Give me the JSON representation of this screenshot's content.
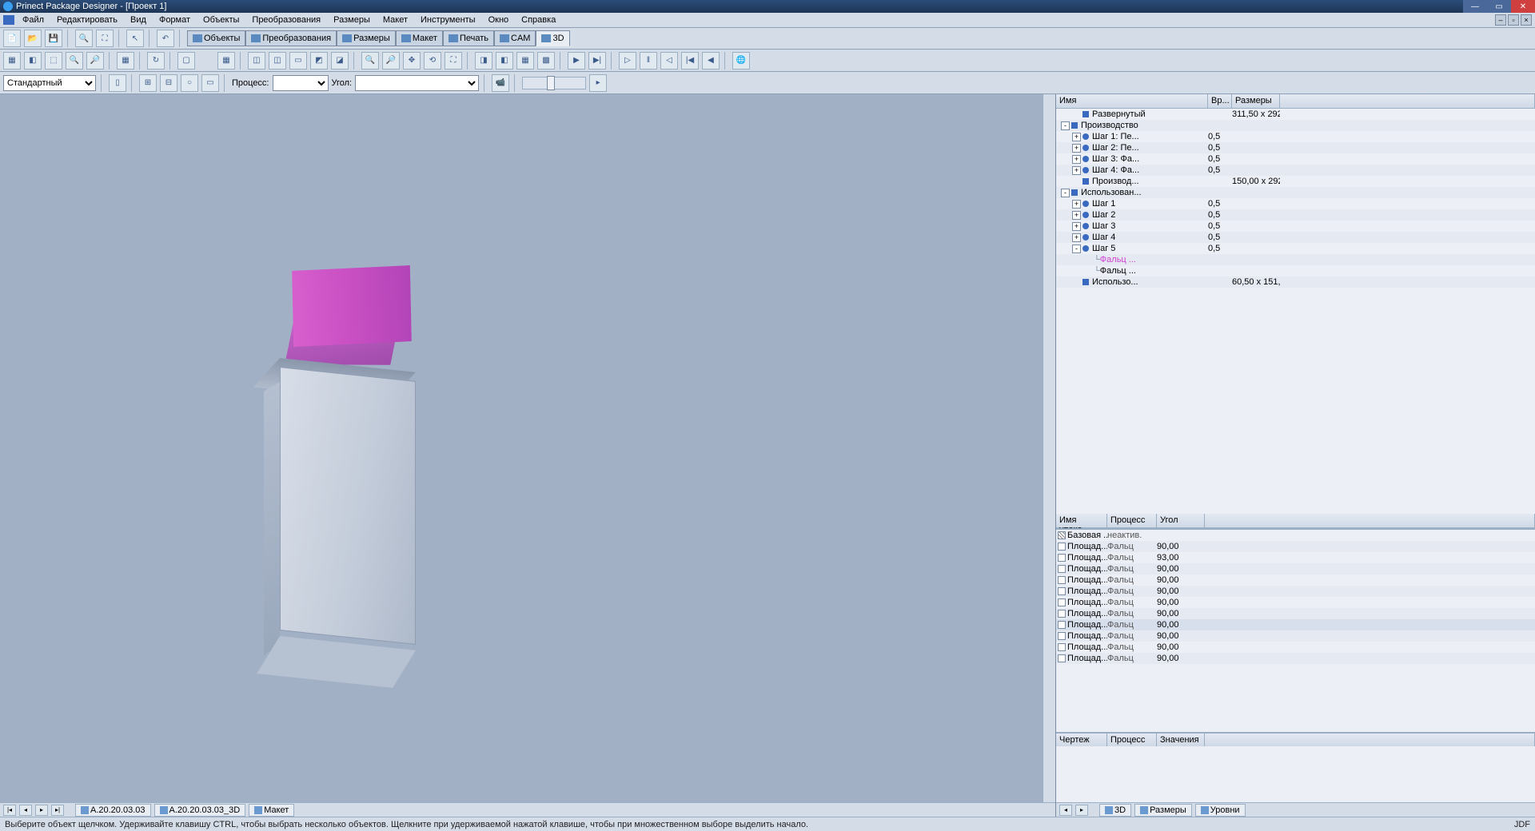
{
  "title": "Prinect Package Designer - [Проект 1]",
  "menu": [
    "Файл",
    "Редактировать",
    "Вид",
    "Формат",
    "Объекты",
    "Преобразования",
    "Размеры",
    "Макет",
    "Инструменты",
    "Окно",
    "Справка"
  ],
  "tabs": [
    {
      "label": "Объекты",
      "id": "objects"
    },
    {
      "label": "Преобразования",
      "id": "transform"
    },
    {
      "label": "Размеры",
      "id": "dims"
    },
    {
      "label": "Макет",
      "id": "layout"
    },
    {
      "label": "Печать",
      "id": "print"
    },
    {
      "label": "CAM",
      "id": "cam"
    },
    {
      "label": "3D",
      "id": "3d",
      "active": true
    }
  ],
  "toolbar3": {
    "preset": "Стандартный",
    "process_label": "Процесс:",
    "angle_label": "Угол:"
  },
  "tree_headers": {
    "c1": "Имя",
    "c2": "Вр...",
    "c3": "Размеры"
  },
  "tree": [
    {
      "indent": 1,
      "exp": "",
      "icon": "square",
      "label": "Развернутый",
      "t": "",
      "sz": "311,50 x 292,..."
    },
    {
      "indent": 0,
      "exp": "-",
      "icon": "square",
      "label": "Производство",
      "t": "",
      "sz": ""
    },
    {
      "indent": 1,
      "exp": "+",
      "icon": "circle",
      "label": "Шаг 1: Пе...",
      "t": "0,5",
      "sz": ""
    },
    {
      "indent": 1,
      "exp": "+",
      "icon": "circle",
      "label": "Шаг 2: Пе...",
      "t": "0,5",
      "sz": ""
    },
    {
      "indent": 1,
      "exp": "+",
      "icon": "circle",
      "label": "Шаг 3: Фа...",
      "t": "0,5",
      "sz": ""
    },
    {
      "indent": 1,
      "exp": "+",
      "icon": "circle",
      "label": "Шаг 4: Фа...",
      "t": "0,5",
      "sz": ""
    },
    {
      "indent": 1,
      "exp": "",
      "icon": "square",
      "label": "Производ...",
      "t": "",
      "sz": "150,00 x 292,..."
    },
    {
      "indent": 0,
      "exp": "-",
      "icon": "square",
      "label": "Использован...",
      "t": "",
      "sz": ""
    },
    {
      "indent": 1,
      "exp": "+",
      "icon": "circle",
      "label": "Шаг 1",
      "t": "0,5",
      "sz": ""
    },
    {
      "indent": 1,
      "exp": "+",
      "icon": "circle",
      "label": "Шаг 2",
      "t": "0,5",
      "sz": ""
    },
    {
      "indent": 1,
      "exp": "+",
      "icon": "circle",
      "label": "Шаг 3",
      "t": "0,5",
      "sz": ""
    },
    {
      "indent": 1,
      "exp": "+",
      "icon": "circle",
      "label": "Шаг 4",
      "t": "0,5",
      "sz": ""
    },
    {
      "indent": 1,
      "exp": "-",
      "icon": "circle",
      "label": "Шаг 5",
      "t": "0,5",
      "sz": ""
    },
    {
      "indent": 2,
      "exp": "",
      "icon": "",
      "label": "Фальц ...",
      "t": "",
      "sz": "",
      "pink": true,
      "branch": true
    },
    {
      "indent": 2,
      "exp": "",
      "icon": "",
      "label": "Фальц ...",
      "t": "",
      "sz": "",
      "branch": true
    },
    {
      "indent": 1,
      "exp": "",
      "icon": "square",
      "label": "Использо...",
      "t": "",
      "sz": "60,50 x 151,5..."
    }
  ],
  "list_headers": {
    "c1": "Имя упако...",
    "c2": "Процесс",
    "c3": "Угол"
  },
  "list": [
    {
      "name": "Базовая ...",
      "proc": "неактив.",
      "ang": "",
      "chk": "hatch"
    },
    {
      "name": "Площад...",
      "proc": "Фальц",
      "ang": "90,00"
    },
    {
      "name": "Площад...",
      "proc": "Фальц",
      "ang": "93,00"
    },
    {
      "name": "Площад...",
      "proc": "Фальц",
      "ang": "90,00"
    },
    {
      "name": "Площад...",
      "proc": "Фальц",
      "ang": "90,00"
    },
    {
      "name": "Площад...",
      "proc": "Фальц",
      "ang": "90,00"
    },
    {
      "name": "Площад...",
      "proc": "Фальц",
      "ang": "90,00"
    },
    {
      "name": "Площад...",
      "proc": "Фальц",
      "ang": "90,00"
    },
    {
      "name": "Площад...",
      "proc": "Фальц",
      "ang": "90,00",
      "sel": true
    },
    {
      "name": "Площад...",
      "proc": "Фальц",
      "ang": "90,00"
    },
    {
      "name": "Площад...",
      "proc": "Фальц",
      "ang": "90,00"
    },
    {
      "name": "Площад...",
      "proc": "Фальц",
      "ang": "90,00"
    }
  ],
  "panel3_headers": {
    "c1": "Чертеж",
    "c2": "Процесс",
    "c3": "Значения ..."
  },
  "bottom_tabs": [
    {
      "label": "A.20.20.03.03"
    },
    {
      "label": "A.20.20.03.03_3D"
    },
    {
      "label": "Макет"
    }
  ],
  "right_bottom_tabs": [
    {
      "label": "3D"
    },
    {
      "label": "Размеры"
    },
    {
      "label": "Уровни"
    }
  ],
  "status": "Выберите объект щелчком. Удерживайте клавишу CTRL, чтобы выбрать несколько объектов. Щелкните при удерживаемой нажатой клавише, чтобы при множественном выборе выделить начало.",
  "status_right": "JDF"
}
